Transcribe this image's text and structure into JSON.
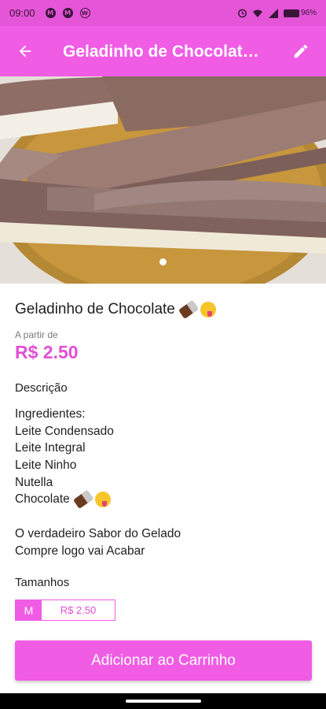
{
  "status_bar": {
    "time": "09:00",
    "notifications": [
      "M",
      "M",
      "W"
    ],
    "battery_text": "96%"
  },
  "app_bar": {
    "back_icon": "arrow-left-icon",
    "title": "Geladinho de Chocolate 🍫😋",
    "edit_icon": "pencil-icon"
  },
  "hero": {
    "image_count": 1,
    "active_index": 0
  },
  "product": {
    "name": "Geladinho de Chocolate",
    "from_label": "A partir de",
    "price": "R$ 2.50",
    "description_title": "Descrição",
    "description_lines": [
      "Ingredientes:",
      "Leite Condensado",
      "Leite Integral",
      "Leite Ninho",
      "Nutella",
      "Chocolate",
      "",
      "O verdadeiro Sabor do Gelado",
      "Compre logo vai Acabar"
    ],
    "sizes_title": "Tamanhos",
    "sizes": [
      {
        "code": "M",
        "price": "R$ 2.50"
      }
    ]
  },
  "cart_button_label": "Adicionar ao Carrinho",
  "colors": {
    "primary": "#f05ce4",
    "status_bar": "#e455d7",
    "price": "#e24fd6"
  }
}
